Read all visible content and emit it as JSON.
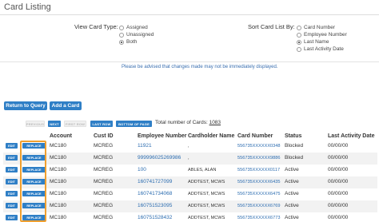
{
  "page": {
    "title": "Card Listing"
  },
  "filters": {
    "view_label": "View Card Type:",
    "view_options": [
      {
        "label": "Assigned",
        "selected": false
      },
      {
        "label": "Unassigned",
        "selected": false
      },
      {
        "label": "Both",
        "selected": true
      }
    ],
    "sort_label": "Sort Card List By:",
    "sort_options": [
      {
        "label": "Card Number",
        "selected": false
      },
      {
        "label": "Employee Number",
        "selected": false
      },
      {
        "label": "Last Name",
        "selected": true
      },
      {
        "label": "Last Activity Date",
        "selected": false
      }
    ]
  },
  "notice": "Please be advised that changes made may not be immediately displayed.",
  "actions": {
    "return_label": "Return to Query",
    "add_label": "Add a Card"
  },
  "pager": {
    "previous": "PREVIOUS",
    "next": "NEXT",
    "first_row": "FIRST ROW",
    "last_row": "LAST ROW",
    "bottom": "BOTTOM OF PAGE",
    "total_label": "Total number of Cards:",
    "total_value": "1083"
  },
  "table": {
    "columns": [
      "Account",
      "Cust ID",
      "Employee Number",
      "Cardholder Name",
      "Card Number",
      "Status",
      "Last Activity Date"
    ],
    "edit_label": "EDIT",
    "replace_label": "REPLACE",
    "rows": [
      {
        "account": "MC180",
        "cust_id": "MCREG",
        "employee": "11921",
        "name": ",",
        "card": "556735XXXXXX0348",
        "status": "Blocked",
        "date": "00/00/00"
      },
      {
        "account": "MC180",
        "cust_id": "MCREG",
        "employee": "999996025269986",
        "name": ",",
        "card": "556735XXXXXX9886",
        "status": "Blocked",
        "date": "00/00/00"
      },
      {
        "account": "MC180",
        "cust_id": "MCREG",
        "employee": "100",
        "name": "ABLES, ALAN",
        "card": "556735XXXXXX0117",
        "status": "Active",
        "date": "00/00/00"
      },
      {
        "account": "MC180",
        "cust_id": "MCREG",
        "employee": "160741727099",
        "name": "ADDTEST, MCWS",
        "card": "556735XXXXXX6435",
        "status": "Active",
        "date": "00/00/00"
      },
      {
        "account": "MC180",
        "cust_id": "MCREG",
        "employee": "160741734068",
        "name": "ADDTEST, MCWS",
        "card": "556735XXXXXX6475",
        "status": "Active",
        "date": "00/00/00"
      },
      {
        "account": "MC180",
        "cust_id": "MCREG",
        "employee": "160751523095",
        "name": "ADDTEST, MCWS",
        "card": "556735XXXXXX6769",
        "status": "Active",
        "date": "00/00/00"
      },
      {
        "account": "MC180",
        "cust_id": "MCREG",
        "employee": "160751528432",
        "name": "ADDTEST, MCWS",
        "card": "556735XXXXXX6773",
        "status": "Active",
        "date": "00/00/00"
      }
    ]
  },
  "colors": {
    "accent": "#2f7fc6",
    "link": "#2b6cb0",
    "highlight": "#f0a030"
  }
}
